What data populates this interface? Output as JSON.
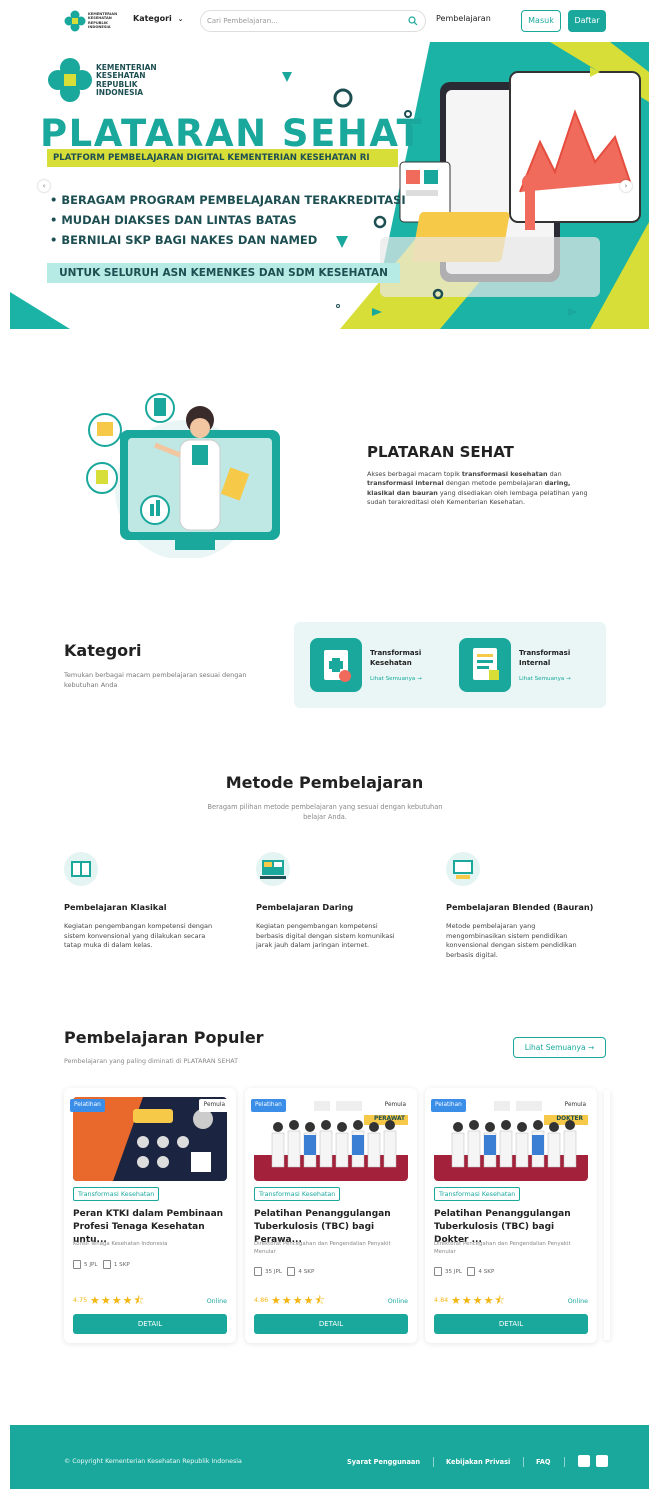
{
  "header": {
    "logo_text": "KEMENTERIAN KESEHATAN REPUBLIK INDONESIA",
    "kategori_label": "Kategori",
    "search_placeholder": "Cari Pembelajaran...",
    "nav_pembelajaran": "Pembelajaran",
    "masuk_label": "Masuk",
    "daftar_label": "Daftar"
  },
  "hero": {
    "logo_lines": [
      "KEMENTERIAN",
      "KESEHATAN",
      "REPUBLIK",
      "INDONESIA"
    ],
    "title": "PLATARAN SEHAT",
    "subtitle": "PLATFORM PEMBELAJARAN DIGITAL KEMENTERIAN KESEHATAN RI",
    "bullets": [
      "BERAGAM PROGRAM PEMBELAJARAN TERAKREDITASI",
      "MUDAH DIAKSES DAN LINTAS BATAS",
      "BERNILAI SKP BAGI NAKES DAN NAMED"
    ],
    "cta": "UNTUK SELURUH ASN KEMENKES DAN SDM KESEHATAN",
    "slide_count": 2,
    "active_slide": 2
  },
  "about": {
    "title": "PLATARAN SEHAT",
    "desc_parts": [
      {
        "text": "Akses berbagai macam topik ",
        "bold": false
      },
      {
        "text": "transformasi kesehatan",
        "bold": true
      },
      {
        "text": " dan ",
        "bold": false
      },
      {
        "text": "transformasi internal",
        "bold": true
      },
      {
        "text": " dengan metode pembelajaran ",
        "bold": false
      },
      {
        "text": "daring, klasikal dan bauran",
        "bold": true
      },
      {
        "text": " yang disediakan oleh lembaga pelatihan yang sudah terakreditasi oleh Kementerian Kesehatan.",
        "bold": false
      }
    ]
  },
  "kategori": {
    "title": "Kategori",
    "desc": "Temukan berbagai macam pembelajaran sesuai dengan kebutuhan Anda",
    "items": [
      {
        "name": "Transformasi Kesehatan",
        "link": "Lihat Semuanya →"
      },
      {
        "name": "Transformasi Internal",
        "link": "Lihat Semuanya →"
      }
    ]
  },
  "metode": {
    "title": "Metode Pembelajaran",
    "desc": "Beragam pilihan metode pembelajaran yang sesuai dengan kebutuhan belajar Anda.",
    "items": [
      {
        "name": "Pembelajaran Klasikal",
        "text": "Kegiatan pengembangan kompetensi dengan sistem konvensional yang dilakukan secara tatap muka di dalam kelas."
      },
      {
        "name": "Pembelajaran Daring",
        "text": "Kegiatan pengembangan kompetensi berbasis digital dengan sistem komunikasi jarak jauh dalam jaringan internet."
      },
      {
        "name": "Pembelajaran Blended (Bauran)",
        "text": "Metode pembelajaran yang mengombinasikan sistem pendidikan konvensional dengan sistem pendidikan berbasis digital."
      }
    ]
  },
  "populer": {
    "title": "Pembelajaran Populer",
    "desc": "Pembelajaran yang paling diminati di PLATARAN SEHAT",
    "see_all": "Lihat Semuanya →",
    "courses": [
      {
        "type": "Pelatihan",
        "level": "Pemula",
        "category": "Transformasi Kesehatan",
        "title": "Peran KTKI dalam Pembinaan Profesi Tenaga Kesehatan untu...",
        "org": "Konsil Tenaga Kesehatan Indonesia",
        "jpl": "5 JPL",
        "skp": "1 SKP",
        "rating": "4.75",
        "stars": 4.5,
        "mode": "Online",
        "button": "DETAIL"
      },
      {
        "type": "Pelatihan",
        "level": "Pemula",
        "category": "Transformasi Kesehatan",
        "title": "Pelatihan Penanggulangan Tuberkulosis (TBC) bagi Perawa...",
        "org": "Direktorat Pencegahan dan Pengendalian Penyakit Menular",
        "jpl": "35 JPL",
        "skp": "4 SKP",
        "rating": "4.86",
        "stars": 4.5,
        "mode": "Online",
        "button": "DETAIL",
        "banner": "PERAWAT"
      },
      {
        "type": "Pelatihan",
        "level": "Pemula",
        "category": "Transformasi Kesehatan",
        "title": "Pelatihan Penanggulangan Tuberkulosis (TBC) bagi Dokter ...",
        "org": "Direktorat Pencegahan dan Pengendalian Penyakit Menular",
        "jpl": "35 JPL",
        "skp": "4 SKP",
        "rating": "4.84",
        "stars": 4.5,
        "mode": "Online",
        "button": "DETAIL",
        "banner": "DOKTER"
      }
    ]
  },
  "footer": {
    "copyright": "© Copyright Kementerian Kesehatan Republik Indonesia",
    "links": [
      "Syarat Penggunaan",
      "Kebijakan Privasi",
      "FAQ"
    ]
  },
  "colors": {
    "primary": "#1aa89c",
    "accent_lime": "#d7de38",
    "dark_teal": "#1d4f52",
    "star": "#f3b510",
    "badge_blue": "#3a8ee8"
  }
}
